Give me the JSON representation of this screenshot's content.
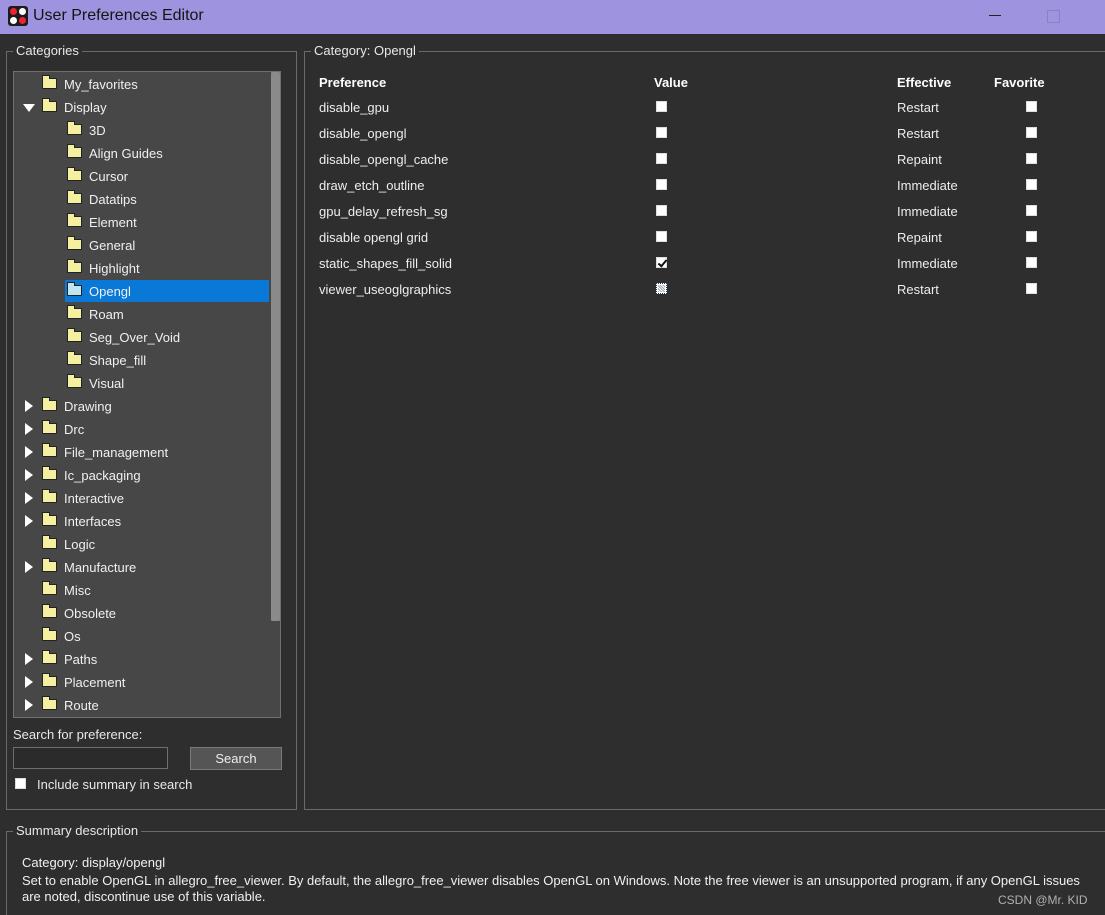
{
  "window": {
    "title": "User Preferences Editor"
  },
  "categories_panel": {
    "legend": "Categories",
    "tree": [
      {
        "label": "My_favorites",
        "level": 0,
        "arrow": "none"
      },
      {
        "label": "Display",
        "level": 0,
        "arrow": "expanded"
      },
      {
        "label": "3D",
        "level": 1,
        "arrow": "none"
      },
      {
        "label": "Align Guides",
        "level": 1,
        "arrow": "none"
      },
      {
        "label": "Cursor",
        "level": 1,
        "arrow": "none"
      },
      {
        "label": "Datatips",
        "level": 1,
        "arrow": "none"
      },
      {
        "label": "Element",
        "level": 1,
        "arrow": "none"
      },
      {
        "label": "General",
        "level": 1,
        "arrow": "none"
      },
      {
        "label": "Highlight",
        "level": 1,
        "arrow": "none"
      },
      {
        "label": "Opengl",
        "level": 1,
        "arrow": "none",
        "selected": true
      },
      {
        "label": "Roam",
        "level": 1,
        "arrow": "none"
      },
      {
        "label": "Seg_Over_Void",
        "level": 1,
        "arrow": "none"
      },
      {
        "label": "Shape_fill",
        "level": 1,
        "arrow": "none"
      },
      {
        "label": "Visual",
        "level": 1,
        "arrow": "none"
      },
      {
        "label": "Drawing",
        "level": 0,
        "arrow": "collapsed"
      },
      {
        "label": "Drc",
        "level": 0,
        "arrow": "collapsed"
      },
      {
        "label": "File_management",
        "level": 0,
        "arrow": "collapsed"
      },
      {
        "label": "Ic_packaging",
        "level": 0,
        "arrow": "collapsed"
      },
      {
        "label": "Interactive",
        "level": 0,
        "arrow": "collapsed"
      },
      {
        "label": "Interfaces",
        "level": 0,
        "arrow": "collapsed"
      },
      {
        "label": "Logic",
        "level": 0,
        "arrow": "none"
      },
      {
        "label": "Manufacture",
        "level": 0,
        "arrow": "collapsed"
      },
      {
        "label": "Misc",
        "level": 0,
        "arrow": "none"
      },
      {
        "label": "Obsolete",
        "level": 0,
        "arrow": "none"
      },
      {
        "label": "Os",
        "level": 0,
        "arrow": "none"
      },
      {
        "label": "Paths",
        "level": 0,
        "arrow": "collapsed"
      },
      {
        "label": "Placement",
        "level": 0,
        "arrow": "collapsed"
      },
      {
        "label": "Route",
        "level": 0,
        "arrow": "collapsed"
      }
    ],
    "search_label": "Search for preference:",
    "search_value": "",
    "search_button": "Search",
    "include_summary_label": "Include summary in search",
    "include_summary_checked": false
  },
  "preferences_panel": {
    "legend": "Category:  Opengl",
    "columns": {
      "preference": "Preference",
      "value": "Value",
      "effective": "Effective",
      "favorite": "Favorite"
    },
    "rows": [
      {
        "name": "disable_gpu",
        "value": "unchecked",
        "effective": "Restart",
        "favorite": false
      },
      {
        "name": "disable_opengl",
        "value": "unchecked",
        "effective": "Restart",
        "favorite": false
      },
      {
        "name": "disable_opengl_cache",
        "value": "unchecked",
        "effective": "Repaint",
        "favorite": false
      },
      {
        "name": "draw_etch_outline",
        "value": "unchecked",
        "effective": "Immediate",
        "favorite": false
      },
      {
        "name": "gpu_delay_refresh_sg",
        "value": "unchecked",
        "effective": "Immediate",
        "favorite": false
      },
      {
        "name": "disable opengl grid",
        "value": "unchecked",
        "effective": "Repaint",
        "favorite": false
      },
      {
        "name": "static_shapes_fill_solid",
        "value": "checked",
        "effective": "Immediate",
        "favorite": false
      },
      {
        "name": "viewer_useoglgraphics",
        "value": "indeterminate",
        "effective": "Restart",
        "favorite": false
      }
    ]
  },
  "summary_panel": {
    "legend": "Summary description",
    "lines": [
      "Category: display/opengl",
      "Set to enable OpenGL in allegro_free_viewer. By default, the allegro_free_viewer disables OpenGL on Windows. Note the free viewer is an unsupported program, if any OpenGL issues",
      "are noted, discontinue use of this variable."
    ]
  },
  "watermark": "CSDN @Mr. KID",
  "colors": {
    "titlebar": "#9d93df",
    "background": "#2e2e2e",
    "tree_background": "#474747",
    "selection": "#0a78d7",
    "folder": "#f4f0a0"
  }
}
